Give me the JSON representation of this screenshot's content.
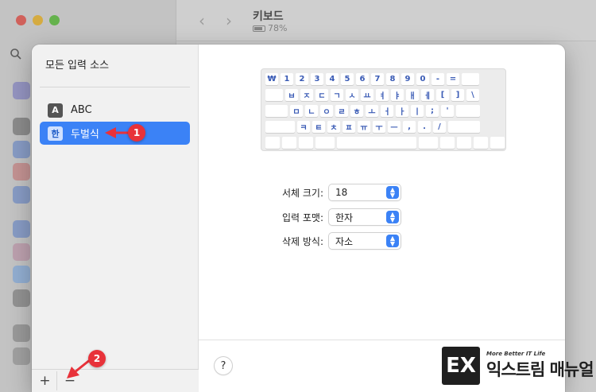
{
  "window": {
    "title": "키보드",
    "battery": "78%"
  },
  "sheet": {
    "sources_title": "모든 입력 소스",
    "sources": [
      {
        "badge": "A",
        "label": "ABC",
        "selected": false
      },
      {
        "badge": "한",
        "label": "두벌식",
        "selected": true
      }
    ],
    "add_label": "+",
    "remove_label": "−",
    "help_label": "?"
  },
  "keyboard": {
    "rows": [
      [
        "₩",
        "1",
        "2",
        "3",
        "4",
        "5",
        "6",
        "7",
        "8",
        "9",
        "0",
        "-",
        "="
      ],
      [
        "ㅂ",
        "ㅈ",
        "ㄷ",
        "ㄱ",
        "ㅅ",
        "ㅛ",
        "ㅕ",
        "ㅑ",
        "ㅐ",
        "ㅔ",
        "[",
        "]",
        "\\"
      ],
      [
        "ㅁ",
        "ㄴ",
        "ㅇ",
        "ㄹ",
        "ㅎ",
        "ㅗ",
        "ㅓ",
        "ㅏ",
        "ㅣ",
        ";",
        "'"
      ],
      [
        "ㅋ",
        "ㅌ",
        "ㅊ",
        "ㅍ",
        "ㅠ",
        "ㅜ",
        "ㅡ",
        ",",
        ".",
        "/"
      ]
    ]
  },
  "form": {
    "font_size": {
      "label": "서체 크기:",
      "value": "18"
    },
    "input_format": {
      "label": "입력 포맷:",
      "value": "한자"
    },
    "delete_method": {
      "label": "삭제 방식:",
      "value": "자소"
    }
  },
  "annotations": {
    "marker1": "1",
    "marker2": "2",
    "color": "#e8323a"
  },
  "watermark": {
    "logo": "EX",
    "subtitle": "More Better IT Life",
    "title": "익스트림 매뉴얼"
  }
}
